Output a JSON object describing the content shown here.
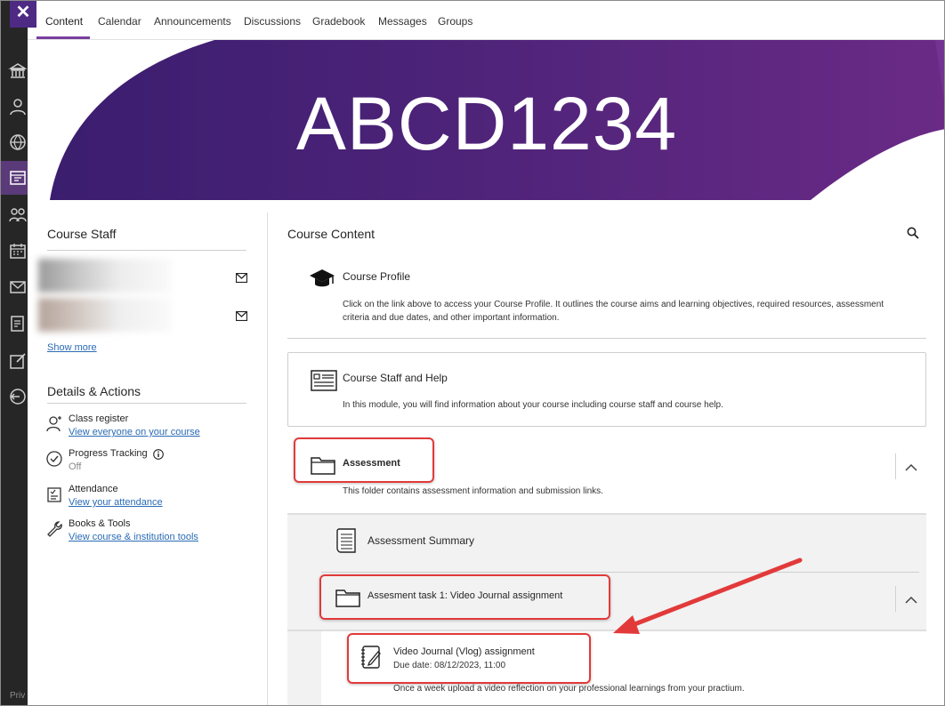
{
  "close_label": "✕",
  "tabs": [
    {
      "label": "Content"
    },
    {
      "label": "Calendar"
    },
    {
      "label": "Announcements"
    },
    {
      "label": "Discussions"
    },
    {
      "label": "Gradebook"
    },
    {
      "label": "Messages"
    },
    {
      "label": "Groups"
    }
  ],
  "banner": {
    "title": "ABCD1234"
  },
  "leftnav": {
    "footer": "Priv"
  },
  "course_staff": {
    "heading": "Course Staff",
    "show_more": "Show more"
  },
  "details": {
    "heading": "Details & Actions",
    "items": [
      {
        "title": "Class register",
        "sub": "View everyone on your course",
        "icon": "class-register-icon"
      },
      {
        "title": "Progress Tracking",
        "sub": "Off",
        "icon": "progress-check-icon"
      },
      {
        "title": "Attendance",
        "sub": "View your attendance",
        "icon": "attendance-icon"
      },
      {
        "title": "Books & Tools",
        "sub": "View course & institution tools",
        "icon": "wrench-icon"
      }
    ]
  },
  "course_content": {
    "heading": "Course Content",
    "items": [
      {
        "title": "Course Profile",
        "desc": "Click on the link above to access your Course Profile. It outlines the course aims and learning objectives, required resources, assessment criteria and due dates, and other important information."
      },
      {
        "title": "Course Staff and Help",
        "desc": "In this module, you will find information about your course including course staff and course help."
      },
      {
        "title": "Assessment",
        "desc": "This folder contains assessment information and submission links."
      },
      {
        "title": "Assessment Summary"
      },
      {
        "title": "Assesment task 1: Video Journal assignment"
      },
      {
        "title": "Video Journal (Vlog) assignment",
        "due": "Due date: 08/12/2023, 11:00",
        "desc": "Once a week upload a video reflection on your professional learnings from your practium."
      }
    ]
  },
  "colors": {
    "brand": "#4e2a84",
    "highlight": "#e23a3a",
    "link": "#2a6bb5"
  }
}
